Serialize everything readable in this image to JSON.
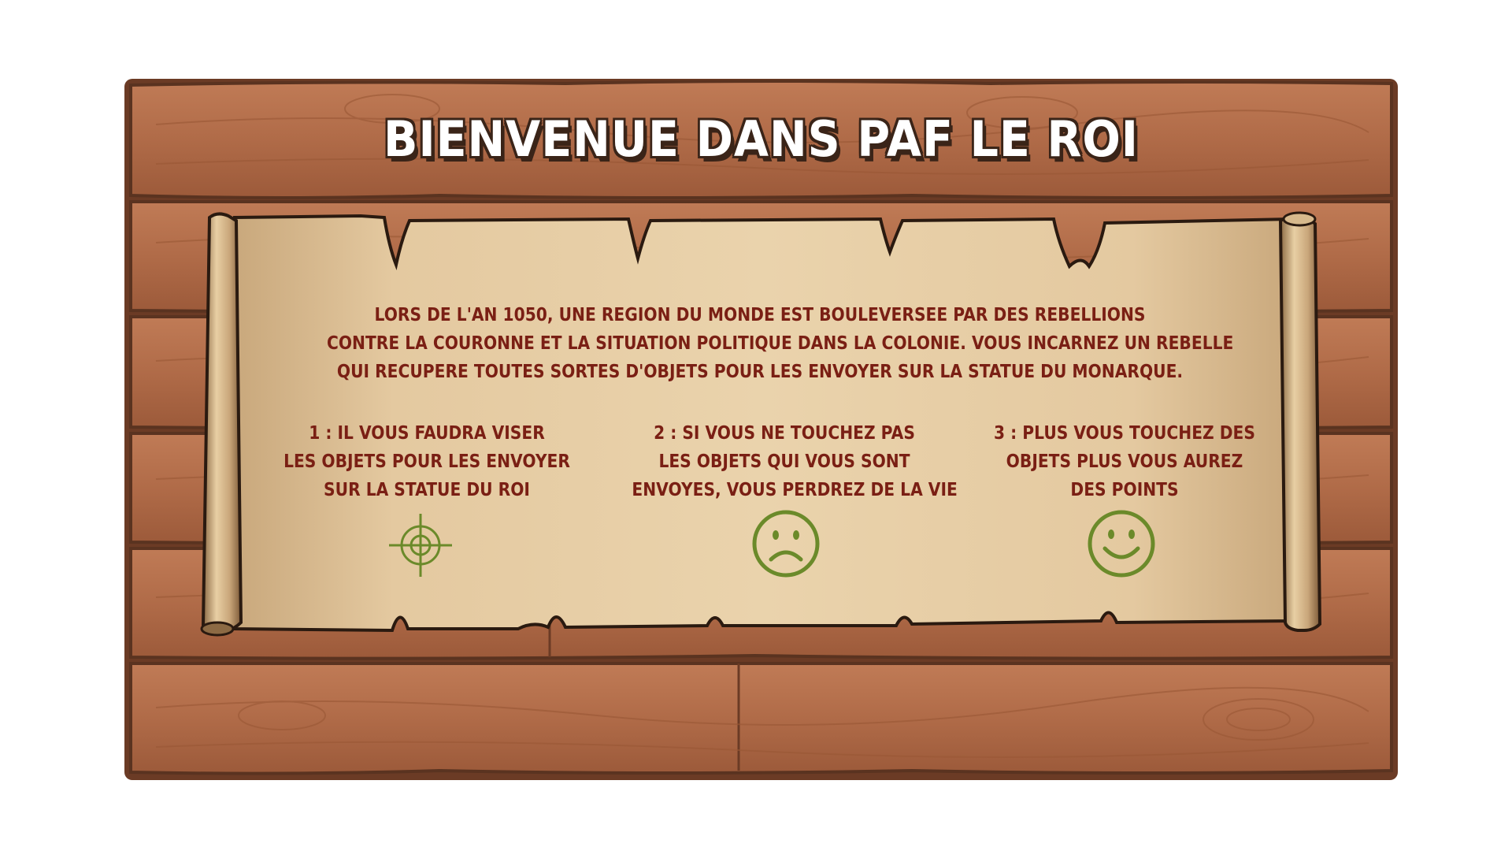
{
  "title": "BIENVENUE DANS PAF LE ROI",
  "intro": {
    "lines": [
      "LORS DE L'AN 1050, UNE REGION DU MONDE EST BOULEVERSEE PAR DES REBELLIONS",
      "CONTRE LA COURONNE ET LA SITUATION POLITIQUE DANS LA COLONIE. VOUS INCARNEZ UN REBELLE",
      "QUI RECUPERE TOUTES SORTES D'OBJETS POUR LES ENVOYER SUR LA STATUE DU MONARQUE."
    ]
  },
  "rules": [
    {
      "lines": [
        "1 : IL VOUS FAUDRA VISER",
        "LES OBJETS POUR LES ENVOYER",
        "SUR LA STATUE DU ROI"
      ],
      "icon": "crosshair-icon"
    },
    {
      "lines": [
        "2 : SI VOUS NE TOUCHEZ PAS",
        "LES OBJETS QUI VOUS SONT",
        "ENVOYES, VOUS PERDREZ DE LA VIE"
      ],
      "icon": "sad-face-icon"
    },
    {
      "lines": [
        "3 : PLUS VOUS TOUCHEZ DES",
        "OBJETS PLUS VOUS AUREZ",
        "DES POINTS"
      ],
      "icon": "smiley-face-icon"
    }
  ],
  "colors": {
    "wood": "#b06b48",
    "wood_dark": "#5a3320",
    "parchment": "#e2c59a",
    "text": "#7a1f14",
    "icon": "#6b8a2a"
  }
}
